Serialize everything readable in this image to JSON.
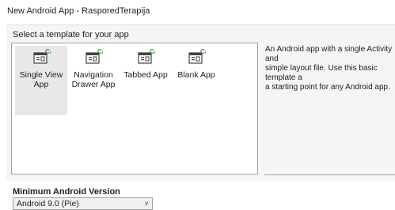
{
  "window": {
    "title": "New Android App - RasporedTerapija"
  },
  "template_section": {
    "label": "Select a template for your app"
  },
  "templates": [
    {
      "label": "Single View App",
      "icon": "single-view-app-icon",
      "selected": true
    },
    {
      "label": "Navigation\nDrawer App",
      "icon": "navigation-drawer-app-icon",
      "selected": false
    },
    {
      "label": "Tabbed App",
      "icon": "tabbed-app-icon",
      "selected": false
    },
    {
      "label": "Blank App",
      "icon": "blank-app-icon",
      "selected": false
    }
  ],
  "description": "An Android app with a single Activity and\nsimple layout file. Use this basic template a\na starting point for any Android app.",
  "min_version": {
    "label": "Minimum Android Version",
    "selected": "Android 9.0 (Pie)"
  },
  "colors": {
    "icon_accent": "#3c9a3c",
    "icon_frame": "#424242",
    "selection": "#e8e8e8"
  }
}
